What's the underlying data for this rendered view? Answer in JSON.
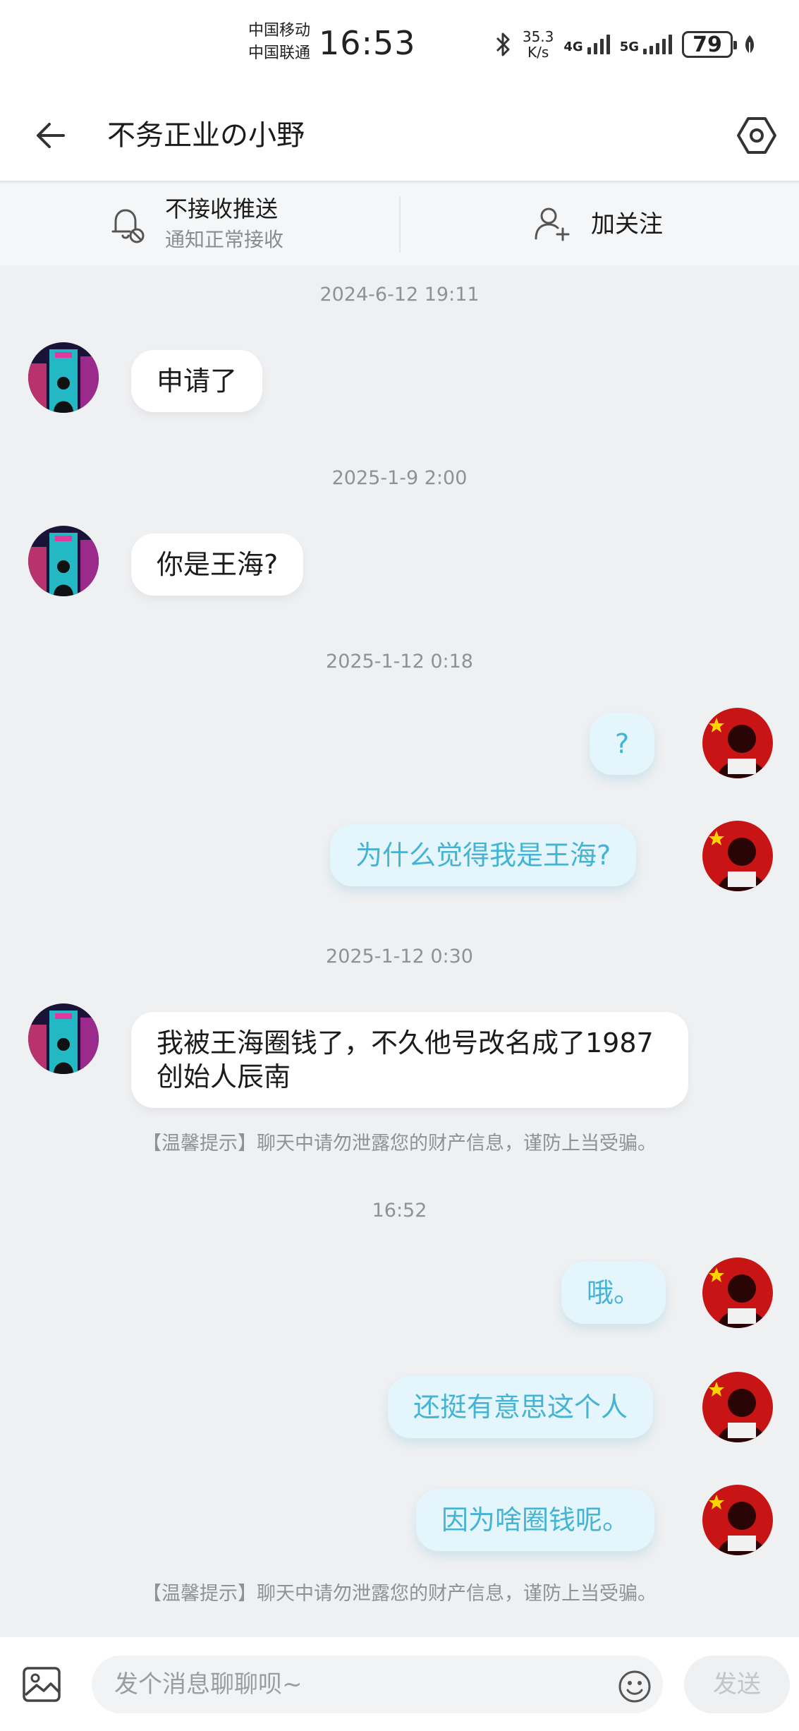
{
  "status_bar": {
    "carrier_1": "中国移动",
    "carrier_2": "中国联通",
    "time": "16:53",
    "speed_value": "35.3",
    "speed_unit": "K/s",
    "network_1": "4G",
    "network_2": "5G",
    "battery": "79"
  },
  "header": {
    "title": "不务正业の小野",
    "back_icon": "arrow-left-icon",
    "settings_icon": "hexagon-settings-icon"
  },
  "notify_strip": {
    "push_label": "不接收推送",
    "push_sub": "通知正常接收",
    "follow_label": "加关注"
  },
  "messages": [
    {
      "type": "timestamp",
      "text": "2024-6-12 19:11"
    },
    {
      "type": "incoming",
      "text": "申请了"
    },
    {
      "type": "timestamp",
      "text": "2025-1-9 2:00"
    },
    {
      "type": "incoming",
      "text": "你是王海?"
    },
    {
      "type": "timestamp",
      "text": "2025-1-12 0:18"
    },
    {
      "type": "outgoing",
      "text": "?"
    },
    {
      "type": "outgoing",
      "text": "为什么觉得我是王海?"
    },
    {
      "type": "timestamp",
      "text": "2025-1-12 0:30"
    },
    {
      "type": "incoming",
      "text": "我被王海圈钱了，不久他号改名成了1987创始人辰南"
    },
    {
      "type": "tip",
      "text": "【温馨提示】聊天中请勿泄露您的财产信息，谨防上当受骗。"
    },
    {
      "type": "timestamp",
      "text": "16:52"
    },
    {
      "type": "outgoing",
      "text": "哦。"
    },
    {
      "type": "outgoing",
      "text": "还挺有意思这个人"
    },
    {
      "type": "outgoing",
      "text": "因为啥圈钱呢。"
    },
    {
      "type": "tip",
      "text": "【温馨提示】聊天中请勿泄露您的财产信息，谨防上当受骗。"
    }
  ],
  "input_bar": {
    "placeholder": "发个消息聊聊呗~",
    "send_label": "发送"
  },
  "colors": {
    "outgoing_bubble": "#e4f6fb",
    "outgoing_text": "#45b3d3",
    "background": "#eff0f2"
  }
}
